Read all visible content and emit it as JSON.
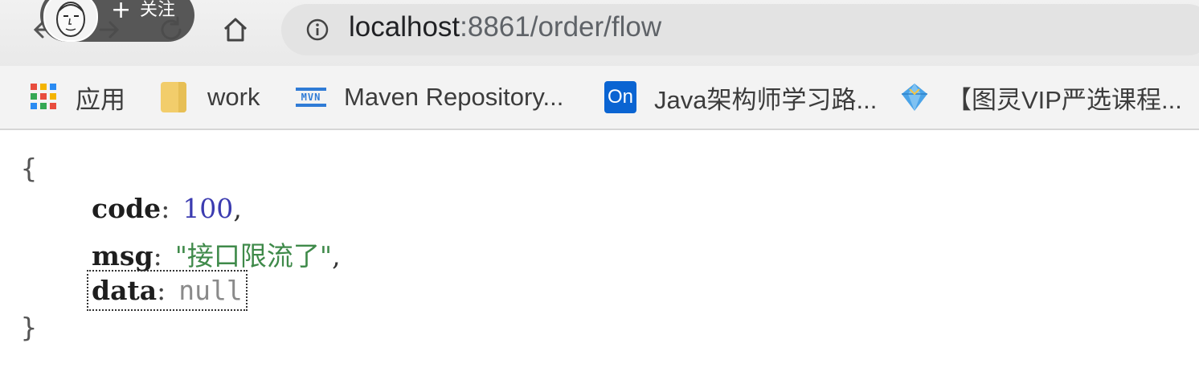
{
  "browser": {
    "url_host": "localhost",
    "url_rest": ":8861/order/flow",
    "follow_overlay": {
      "plus": "+",
      "label": "关注"
    }
  },
  "bookmarks": [
    {
      "label": "应用",
      "icon": "apps-grid-icon"
    },
    {
      "label": "work",
      "icon": "folder-icon"
    },
    {
      "label": "Maven Repository...",
      "icon": "maven-icon"
    },
    {
      "label": "Java架构师学习路...",
      "icon": "onenote-icon"
    },
    {
      "label": "【图灵VIP严选课程...",
      "icon": "diamond-icon"
    }
  ],
  "maven_icon_text": "MVN",
  "onenote_icon_text": "On",
  "json_view": {
    "open_brace": "{",
    "close_brace": "}",
    "rows": [
      {
        "key": "code",
        "value": "100",
        "comma": ","
      },
      {
        "key": "msg",
        "value": "\"接口限流了\"",
        "comma": ","
      },
      {
        "key": "data",
        "value": "null",
        "comma": ""
      }
    ]
  },
  "colors": {
    "number": "#3b3bb0",
    "string": "#3f8a4a",
    "null": "#8a8a8a"
  }
}
